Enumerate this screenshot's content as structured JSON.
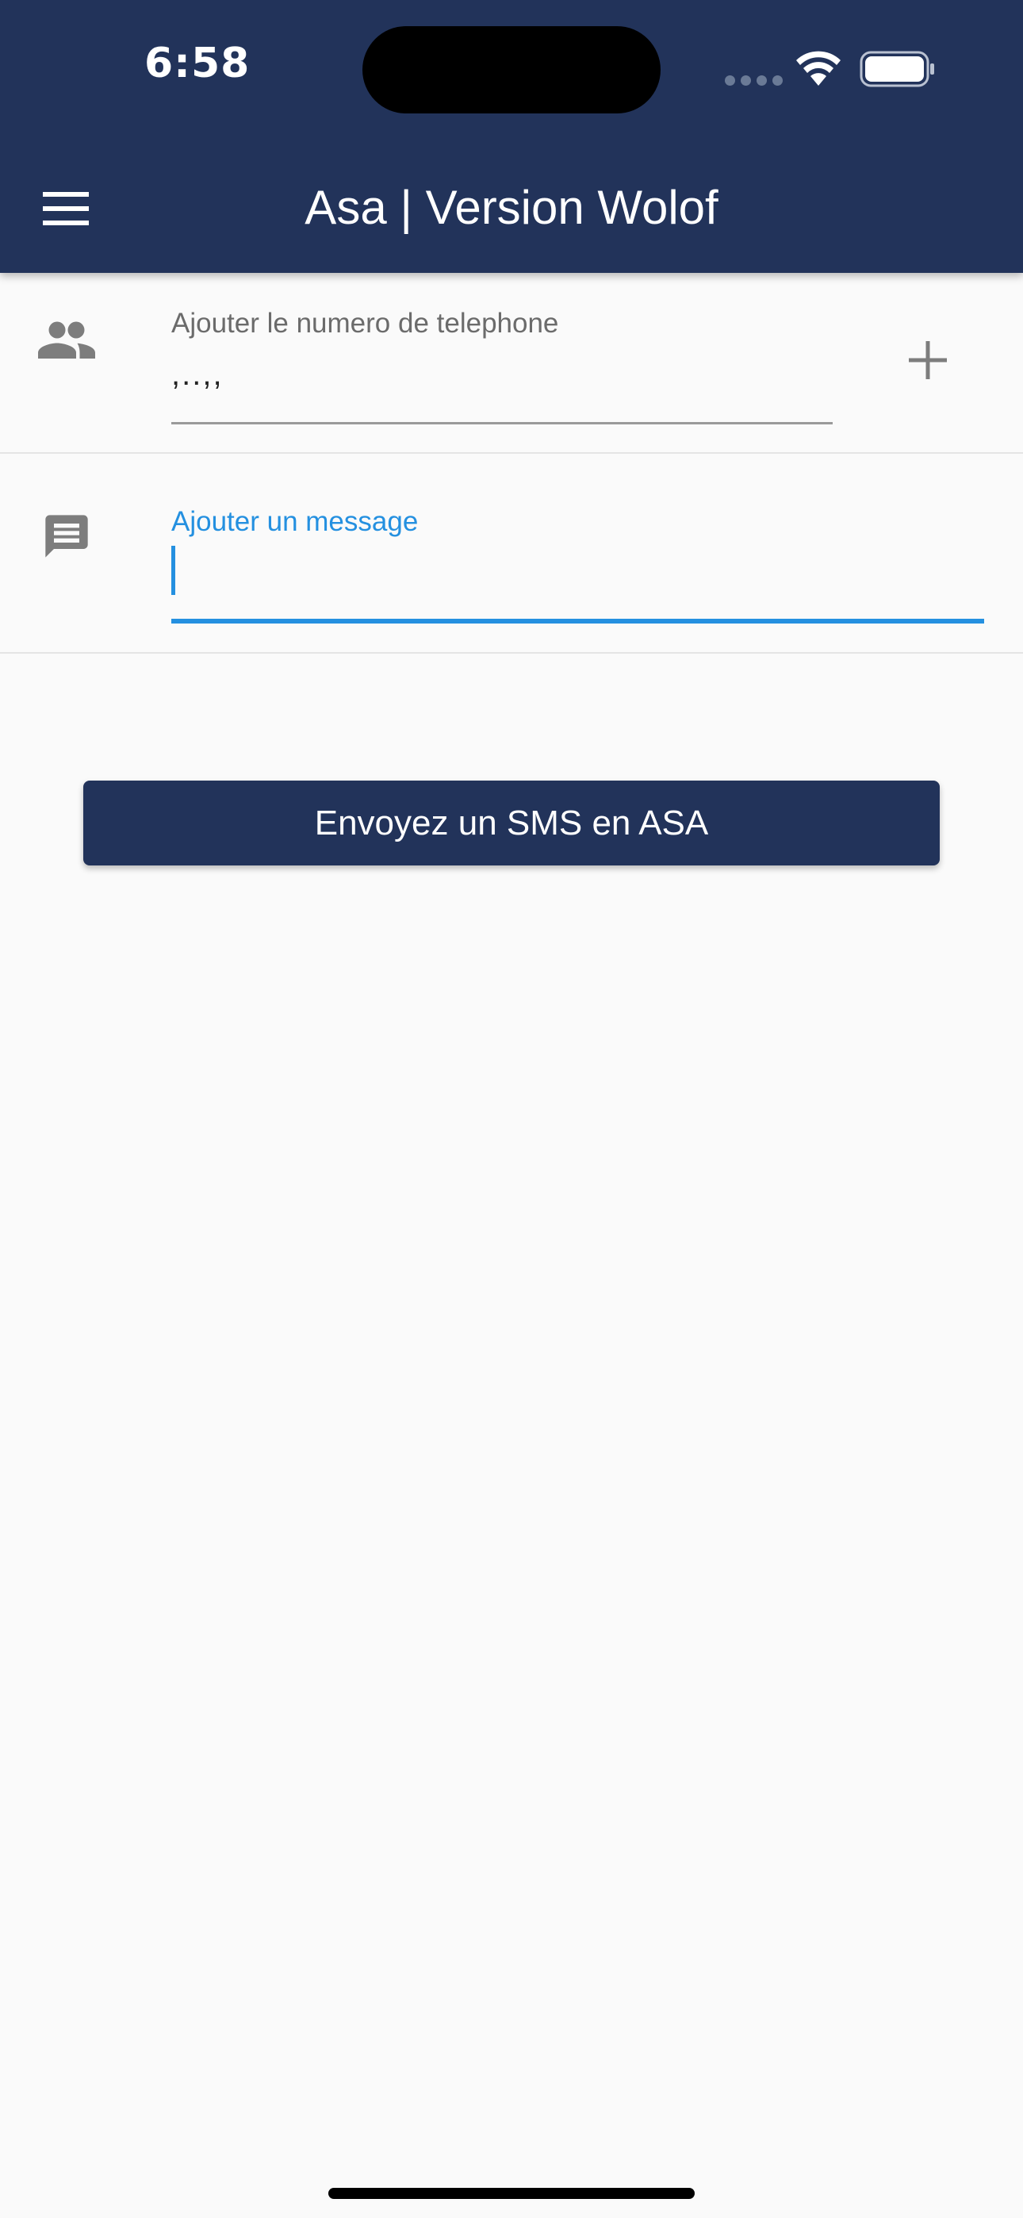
{
  "status_bar": {
    "time": "6:58"
  },
  "app_bar": {
    "title": "Asa | Version Wolof",
    "color": "#22335a",
    "menu_icon": "hamburger-menu-icon"
  },
  "phone_field": {
    "icon": "people-icon",
    "label": "Ajouter le numero de telephone",
    "value": ",..,,",
    "add_icon": "plus-icon"
  },
  "message_field": {
    "icon": "chat-message-icon",
    "label": "Ajouter un message",
    "value": "",
    "focused": true,
    "accent_color": "#2490e0"
  },
  "send_button": {
    "label": "Envoyez un SMS en ASA"
  }
}
